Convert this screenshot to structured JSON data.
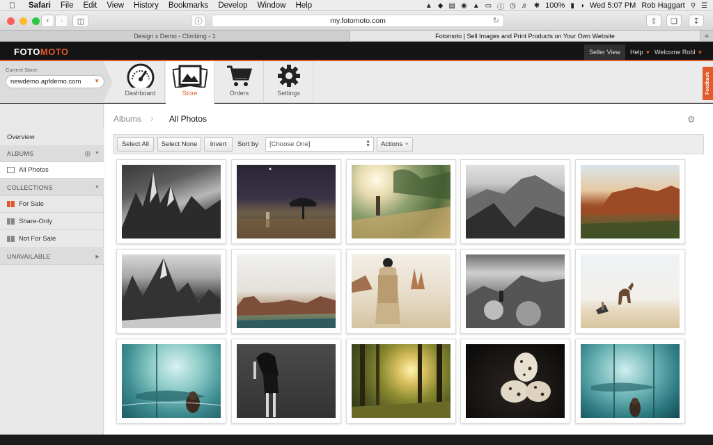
{
  "menubar": {
    "items": [
      "Safari",
      "File",
      "Edit",
      "View",
      "History",
      "Bookmarks",
      "Develop",
      "Window",
      "Help"
    ],
    "battery": "100%",
    "clock": "Wed 5:07 PM",
    "user": "Rob Haggart"
  },
  "browser": {
    "url": "my.fotomoto.com",
    "tabs": [
      "Design x Demo - Climbing - 1",
      "Fotomoto | Sell Images and Print Products on Your Own Website"
    ],
    "plus": "+"
  },
  "topnav": {
    "logo_a": "FOTO",
    "logo_b": "MOTO",
    "seller_view": "Seller View",
    "help": "Help",
    "welcome": "Welcome Robl"
  },
  "store": {
    "label": "Current Store:",
    "value": "newdemo.apfdemo.com"
  },
  "nav": {
    "dashboard": "Dashboard",
    "store": "Store",
    "orders": "Orders",
    "settings": "Settings"
  },
  "feedback": "Feedback",
  "sidebar": {
    "overview": "Overview",
    "albums": "ALBUMS",
    "all_photos": "All Photos",
    "collections": "COLLECTIONS",
    "for_sale": "For Sale",
    "share_only": "Share-Only",
    "not_for_sale": "Not For Sale",
    "unavailable": "UNAVAILABLE"
  },
  "breadcrumb": {
    "albums": "Albums",
    "current": "All Photos"
  },
  "toolbar": {
    "select_all": "Select All",
    "select_none": "Select None",
    "invert": "Invert",
    "sort_by": "Sort by",
    "sort_value": "[Choose One]",
    "actions": "Actions"
  },
  "colors": {
    "accent": "#e15a2b",
    "topnav": "#141414"
  },
  "photos": [
    {
      "name": "mountain-peaks-bw"
    },
    {
      "name": "night-desert-figure"
    },
    {
      "name": "sunlit-grass-hiker"
    },
    {
      "name": "mountain-ridge-bw"
    },
    {
      "name": "red-desert-mesa"
    },
    {
      "name": "snowy-peaks-bw"
    },
    {
      "name": "desert-rock-formations"
    },
    {
      "name": "man-in-desert"
    },
    {
      "name": "rocky-landscape-bw"
    },
    {
      "name": "camels-desert"
    },
    {
      "name": "aquarium-whale-shark"
    },
    {
      "name": "dancer-black-dress"
    },
    {
      "name": "sunlit-forest"
    },
    {
      "name": "quail-eggs"
    },
    {
      "name": "aquarium-child"
    }
  ]
}
